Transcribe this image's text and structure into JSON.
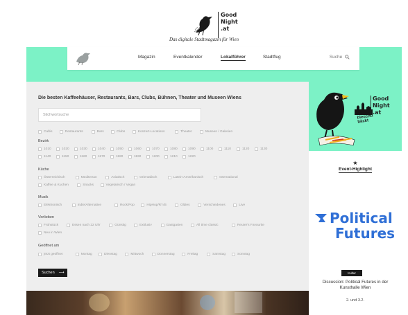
{
  "header": {
    "logo_lines": [
      "Good",
      "Night",
      ".at"
    ],
    "tagline": "Das digitale Stadtmagazin für Wien"
  },
  "nav": {
    "items": [
      {
        "label": "Magazin",
        "active": false
      },
      {
        "label": "Eventkalender",
        "active": false
      },
      {
        "label": "Lokalführer",
        "active": true
      },
      {
        "label": "Stadtflug",
        "active": false
      }
    ],
    "search_label": "Suche"
  },
  "main": {
    "heading": "Die besten Kaffeehäuser, Restaurants, Bars, Clubs, Bühnen, Theater und Museen Wiens",
    "search_placeholder": "Stichwortsuche",
    "categories": [
      "Cafés",
      "Restaurants",
      "Bars",
      "Clubs",
      "Konzert-Locations",
      "Theater",
      "Museen / Galerien"
    ],
    "bezirk_label": "Bezirk",
    "bezirke_row1": [
      "1010",
      "1020",
      "1030",
      "1040",
      "1050",
      "1060",
      "1070",
      "1080",
      "1090",
      "1100",
      "1110",
      "1120",
      "1130"
    ],
    "bezirke_row2": [
      "1140",
      "1150",
      "1160",
      "1170",
      "1180",
      "1190",
      "1200",
      "1210",
      "1220"
    ],
    "kueche_label": "Küche",
    "kueche_row1": [
      "Österreichisch",
      "Mediterran",
      "Asiatisch",
      "Orientalisch",
      "Latein-Amerikanisch",
      "International"
    ],
    "kueche_row2": [
      "Kaffee & Kuchen",
      "Snacks",
      "Vegetarisch / Vegan"
    ],
    "musik_label": "Musik",
    "musik": [
      "Elektronisch",
      "Indie/Alternative",
      "Rock/Pop",
      "HipHop/R'n'B",
      "Oldies",
      "Verschiedenes",
      "Live"
    ],
    "vorlieben_label": "Vorlieben",
    "vorlieben_row1": [
      "Frühstück",
      "Essen nach 22 Uhr",
      "Günstig",
      "Exklusiv",
      "Gastgarten",
      "All time classic",
      "Reuter's Favourite"
    ],
    "vorlieben_row2": [
      "Neu in Wien"
    ],
    "geoeffnet_label": "Geöffnet am",
    "geoeffnet": [
      "jetzt geöffnet",
      "Montag",
      "Dienstag",
      "Mittwoch",
      "Donnerstag",
      "Freitag",
      "Samstag",
      "Sonntag"
    ],
    "submit_label": "Suchen",
    "submit_arrow": "⟶"
  },
  "sidebar": {
    "ad_logo_lines": [
      "Good",
      "Night",
      ".at"
    ],
    "ad_script_lines": [
      "bleuchti",
      "bäckt"
    ],
    "star": "★",
    "event_highlight": "Event-Highlight",
    "poster_line1": "Political",
    "poster_line2": "Futures",
    "badge": "Kultur",
    "event_title": "Discussion: Political Futures in der Kunsthalle Wien",
    "event_date": "2. und 3.2."
  },
  "colors": {
    "mint": "#7cf2c6",
    "panel": "#eeeeee",
    "poster_blue": "#2f6fd6",
    "button": "#1a1a1a"
  }
}
